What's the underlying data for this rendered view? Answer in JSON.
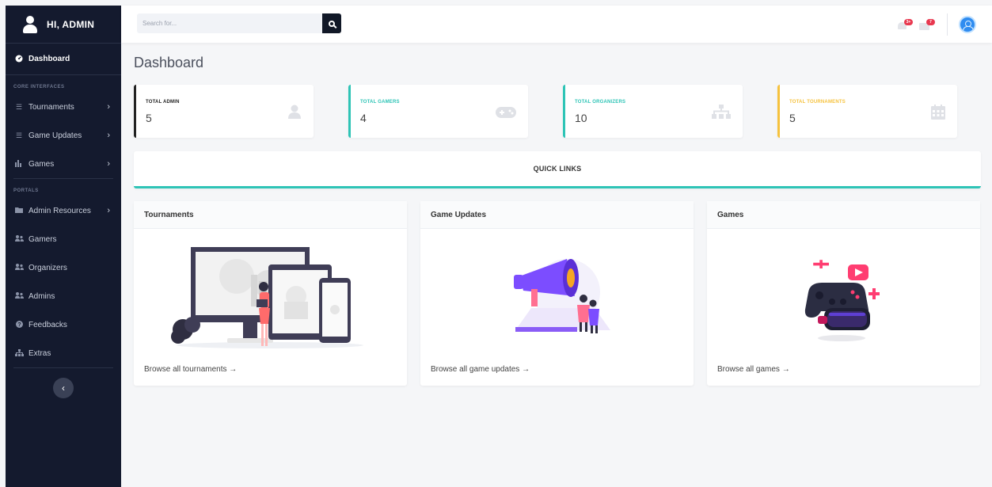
{
  "sidebar": {
    "brand": "HI, ADMIN",
    "dashboard_label": "Dashboard",
    "section_core": "CORE INTERFACES",
    "section_portals": "PORTALS",
    "items_core": [
      {
        "label": "Tournaments",
        "has_chevron": "›"
      },
      {
        "label": "Game Updates",
        "has_chevron": "›"
      },
      {
        "label": "Games",
        "has_chevron": "›"
      }
    ],
    "items_portals": [
      {
        "label": "Admin Resources",
        "has_chevron": "›"
      },
      {
        "label": "Gamers"
      },
      {
        "label": "Organizers"
      },
      {
        "label": "Admins"
      },
      {
        "label": "Feedbacks"
      },
      {
        "label": "Extras"
      }
    ],
    "toggle_glyph": "‹"
  },
  "topbar": {
    "search_placeholder": "Search for...",
    "alerts_badge": "3+",
    "messages_badge": "7"
  },
  "page": {
    "title": "Dashboard"
  },
  "stats": [
    {
      "label": "TOTAL ADMIN",
      "value": "5",
      "accent": "#222222"
    },
    {
      "label": "TOTAL GAMERS",
      "value": "4",
      "accent": "#2ec4b6"
    },
    {
      "label": "TOTAL ORGANIZERS",
      "value": "10",
      "accent": "#2ec4b6"
    },
    {
      "label": "TOTAL TOURNAMENTS",
      "value": "5",
      "accent": "#f6c23e"
    }
  ],
  "quick_links": {
    "title": "QUICK LINKS"
  },
  "cards": [
    {
      "title": "Tournaments",
      "link": "Browse all tournaments →"
    },
    {
      "title": "Game Updates",
      "link": "Browse all game updates →"
    },
    {
      "title": "Games",
      "link": "Browse all games →"
    }
  ],
  "colors": {
    "sidebar_bg": "#141a2e",
    "teal": "#2ec4b6",
    "yellow": "#f6c23e",
    "badge_red": "#e8384f"
  }
}
